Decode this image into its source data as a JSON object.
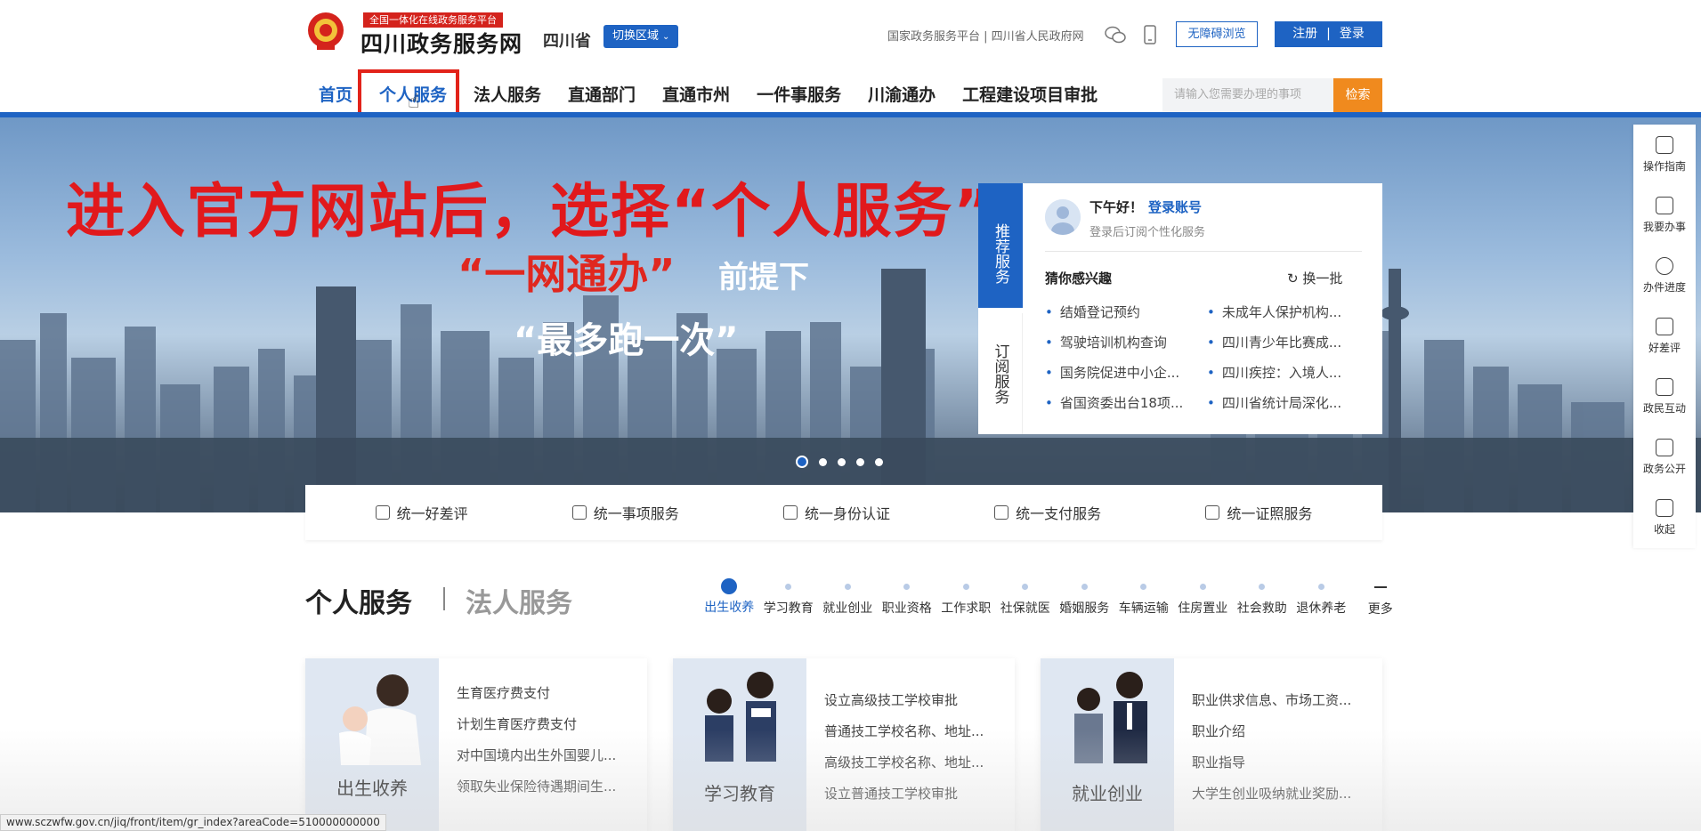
{
  "header": {
    "tagline": "全国一体化在线政务服务平台",
    "site_title": "四川政务服务网",
    "province": "四川省",
    "switch_region": "切换区域",
    "top_links": "国家政务服务平台 | 四川省人民政府网",
    "accessibility": "无障碍浏览",
    "register": "注册",
    "login": "登录",
    "search_placeholder": "请输入您需要办理的事项",
    "search_button": "检索"
  },
  "nav": {
    "items": [
      "首页",
      "个人服务",
      "法人服务",
      "直通部门",
      "直通市州",
      "一件事服务",
      "川渝通办",
      "工程建设项目审批"
    ]
  },
  "banner": {
    "caption": "进入官方网站后，选择“个人服务”",
    "slogan_red": "“一网通办”",
    "slogan_white": "前提下",
    "slogan2": "“最多跑一次”",
    "slide_count": 5,
    "active_slide": 1
  },
  "panel": {
    "tab_recommend": "推荐服务",
    "tab_subscribe": "订阅服务",
    "greeting": "下午好！",
    "login_link": "登录账号",
    "subtitle": "登录后订阅个性化服务",
    "interest_title": "猜你感兴趣",
    "refresh": "换一批",
    "items": [
      "结婚登记预约",
      "未成年人保护机构...",
      "驾驶培训机构查询",
      "四川青少年比赛成...",
      "国务院促进中小企...",
      "四川疾控：入境人...",
      "省国资委出台18项...",
      "四川省统计局深化..."
    ]
  },
  "strip": {
    "items": [
      "统一好差评",
      "统一事项服务",
      "统一身份认证",
      "统一支付服务",
      "统一证照服务"
    ]
  },
  "sidebar": {
    "items": [
      "操作指南",
      "我要办事",
      "办件进度",
      "好差评",
      "政民互动",
      "政务公开",
      "收起"
    ]
  },
  "section": {
    "title_personal": "个人服务",
    "title_legal": "法人服务",
    "categories": [
      "出生收养",
      "学习教育",
      "就业创业",
      "职业资格",
      "工作求职",
      "社保就医",
      "婚姻服务",
      "车辆运输",
      "住房置业",
      "社会救助",
      "退休养老",
      "更多"
    ]
  },
  "cards": [
    {
      "label": "出生收养",
      "links": [
        "生育医疗费支付",
        "计划生育医疗费支付",
        "对中国境内出生外国婴儿...",
        "领取失业保险待遇期间生..."
      ]
    },
    {
      "label": "学习教育",
      "links": [
        "设立高级技工学校审批",
        "普通技工学校名称、地址...",
        "高级技工学校名称、地址...",
        "设立普通技工学校审批"
      ]
    },
    {
      "label": "就业创业",
      "links": [
        "职业供求信息、市场工资...",
        "职业介绍",
        "职业指导",
        "大学生创业吸纳就业奖励..."
      ]
    }
  ],
  "status_url": "www.sczwfw.gov.cn/jiq/front/item/gr_index?areaCode=510000000000",
  "colors": {
    "primary": "#1e63c3",
    "accent_red": "#e2231a",
    "search_orange": "#f08a1e"
  }
}
